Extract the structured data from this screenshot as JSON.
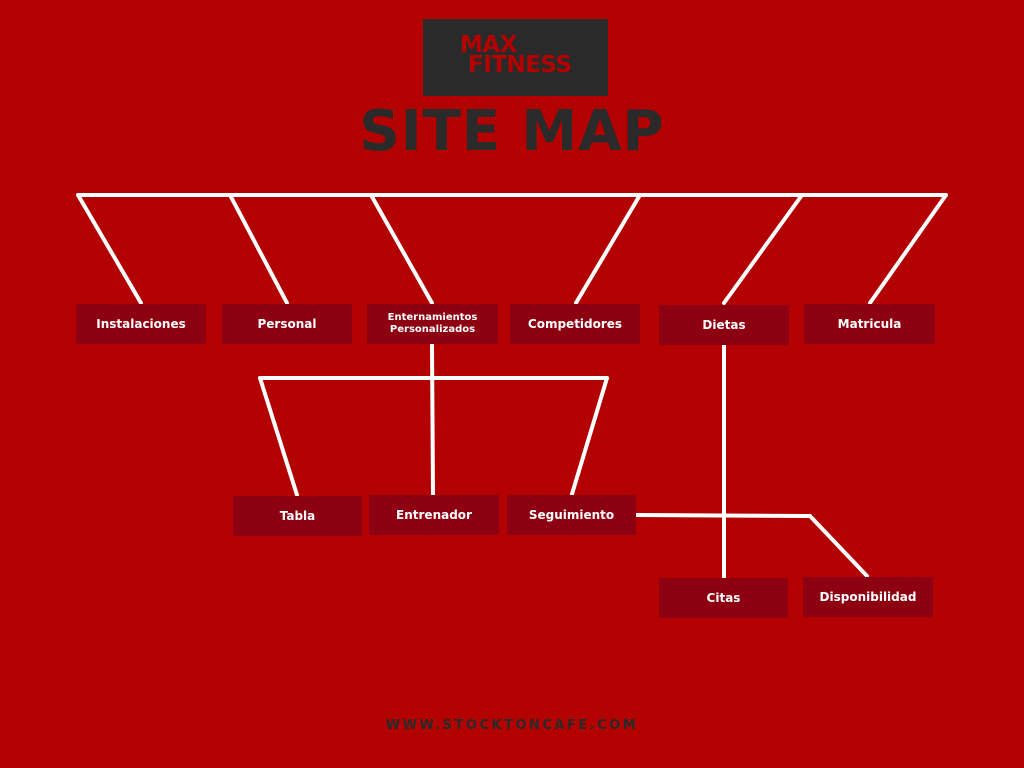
{
  "colors": {
    "background": "#b30000",
    "node": "#8c0011",
    "dark": "#2a2a2a",
    "line": "#ffffff"
  },
  "logo": {
    "line1": "MAX",
    "line2": "FITNESS"
  },
  "title": "SITE MAP",
  "nodes": {
    "instalaciones": "Instalaciones",
    "personal": "Personal",
    "entrenamientos_line1": "Enternamientos",
    "entrenamientos_line2": "Personalizados",
    "competidores": "Competidores",
    "dietas": "Dietas",
    "matricula": "Matricula",
    "tabla": "Tabla",
    "entrenador": "Entrenador",
    "seguimiento": "Seguimiento",
    "citas": "Citas",
    "disponibilidad": "Disponibilidad"
  },
  "footer": "WWW.STOCKTONCAFE.COM"
}
